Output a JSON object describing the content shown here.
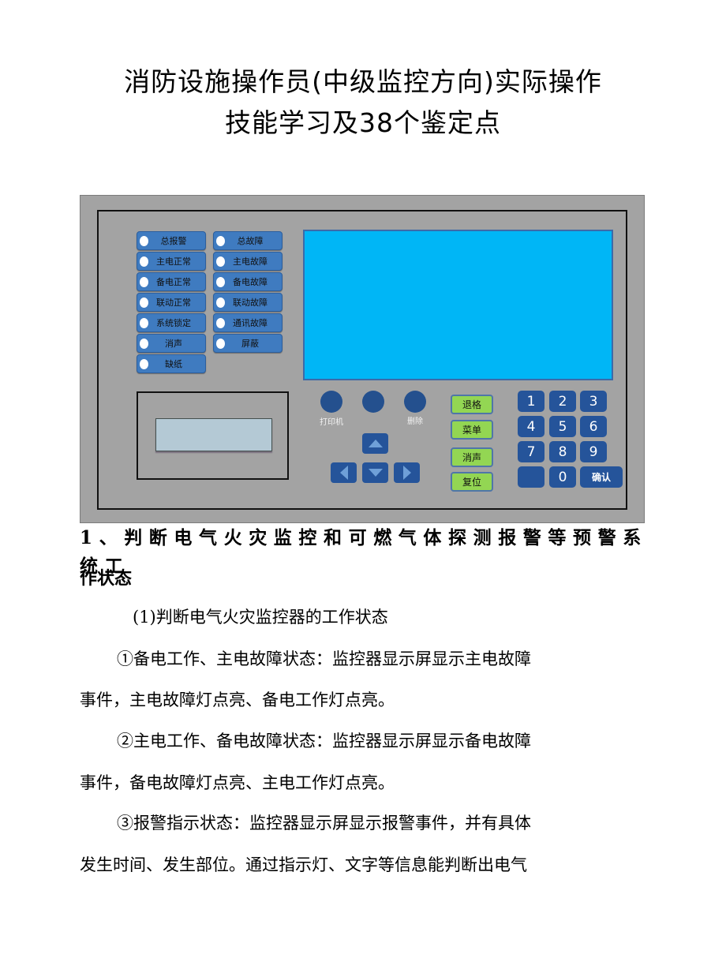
{
  "title": {
    "line1": "消防设施操作员(中级监控方向)实际操作",
    "line2": "技能学习及38个鉴定点"
  },
  "panel": {
    "colors": {
      "panel_bg": "#a3a3a3",
      "indicator_bg": "#3f7bc0",
      "screen": "#00b6f6",
      "function_key": "#93d653",
      "keypad": "#25549a",
      "printer_slot": "#b4c9d5"
    },
    "indicators_left": [
      {
        "label": "总报警"
      },
      {
        "label": "主电正常"
      },
      {
        "label": "备电正常"
      },
      {
        "label": "联动正常"
      },
      {
        "label": "系统锁定"
      },
      {
        "label": "消声"
      },
      {
        "label": "缺纸"
      }
    ],
    "indicators_right": [
      {
        "label": "总故障"
      },
      {
        "label": "主电故障"
      },
      {
        "label": "备电故障"
      },
      {
        "label": "联动故障"
      },
      {
        "label": "通讯故障"
      },
      {
        "label": "屏蔽"
      }
    ],
    "round_buttons": [
      {
        "label": "打印机"
      },
      {
        "label": ""
      },
      {
        "label": "删除"
      }
    ],
    "arrows": [
      "up",
      "left",
      "down",
      "right"
    ],
    "function_keys": [
      {
        "label": "退格"
      },
      {
        "label": "菜单"
      },
      {
        "label": "消声"
      },
      {
        "label": "复位"
      }
    ],
    "keypad": [
      "1",
      "2",
      "3",
      "4",
      "5",
      "6",
      "7",
      "8",
      "9",
      "",
      "0",
      "确认"
    ]
  },
  "section": {
    "heading_line1": "1、判断电气火灾监控和可燃气体探测报警等预警系统工",
    "heading_line2": "作状态",
    "subheading": "(1)判断电气火灾监控器的工作状态",
    "items": [
      {
        "line1": "①备电工作、主电故障状态：监控器显示屏显示主电故障",
        "line2": "事件，主电故障灯点亮、备电工作灯点亮。"
      },
      {
        "line1": "②主电工作、备电故障状态：监控器显示屏显示备电故障",
        "line2": "事件，备电故障灯点亮、主电工作灯点亮。"
      },
      {
        "line1": "③报警指示状态：监控器显示屏显示报警事件，并有具体",
        "line2": "发生时间、发生部位。通过指示灯、文字等信息能判断出电气"
      }
    ]
  }
}
